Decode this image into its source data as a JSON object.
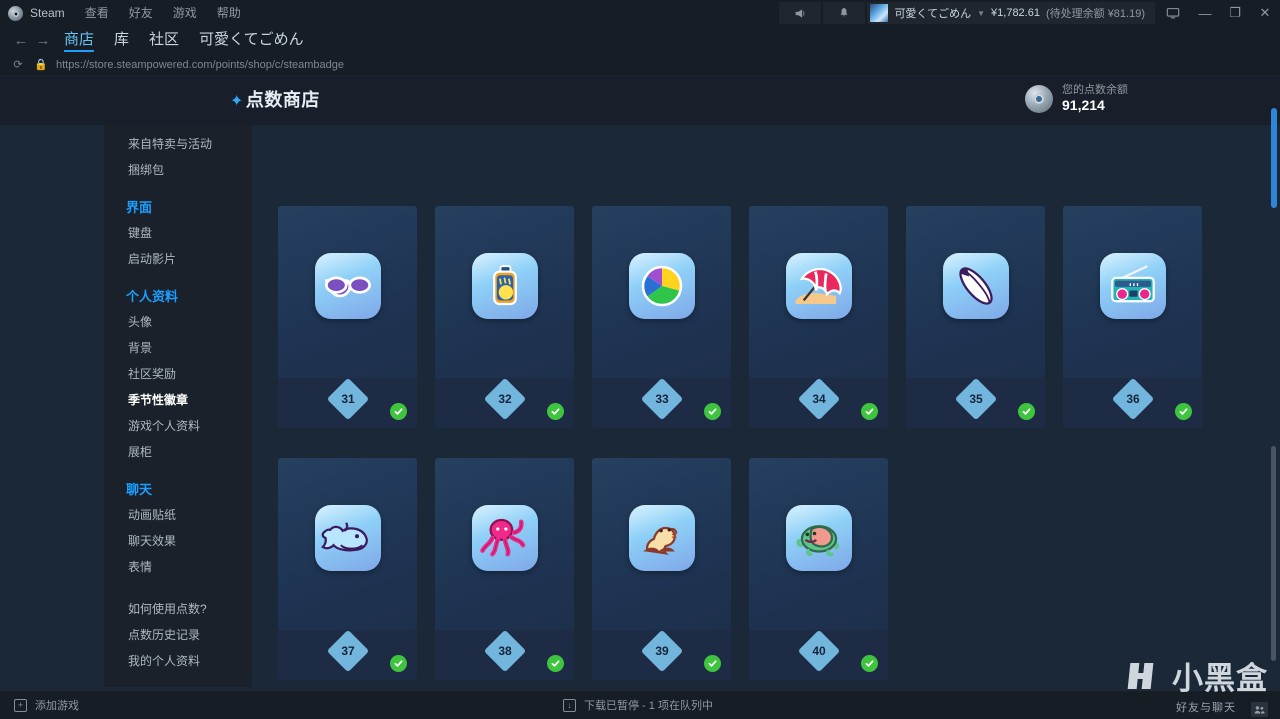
{
  "window": {
    "brand": "Steam",
    "menus": [
      "查看",
      "好友",
      "游戏",
      "帮助"
    ],
    "broadcast_icon": "megaphone-icon",
    "notifications_icon": "bell-icon",
    "account_name": "可愛くてごめん",
    "account_balance": "¥1,782.61",
    "account_pending": "(待处理余额 ¥81.19)",
    "caret_icon": "chevron-down-icon",
    "bigpicture_icon": "display-icon",
    "minimize_icon": "—",
    "maximize_icon": "❐",
    "close_icon": "✕"
  },
  "nav": {
    "back_icon": "←",
    "forward_icon": "→",
    "tabs": [
      {
        "label": "商店",
        "active": true
      },
      {
        "label": "库",
        "active": false
      },
      {
        "label": "社区",
        "active": false
      },
      {
        "label": "可愛くてごめん",
        "active": false
      }
    ],
    "reload_icon": "reload-icon",
    "lock_icon": "lock-icon",
    "url": "https://store.steampowered.com/points/shop/c/steambadge"
  },
  "shop": {
    "sparkle_icon": "sparkle-icon",
    "title": "点数商店",
    "points_icon": "steam-points-icon",
    "points_label": "您的点数余额",
    "points_value": "91,214"
  },
  "sidebar": {
    "items": [
      {
        "label": "来自特卖与活动",
        "type": "item"
      },
      {
        "label": "捆绑包",
        "type": "item"
      },
      {
        "label": "界面",
        "type": "head"
      },
      {
        "label": "键盘",
        "type": "item"
      },
      {
        "label": "启动影片",
        "type": "item"
      },
      {
        "label": "个人资料",
        "type": "head"
      },
      {
        "label": "头像",
        "type": "item"
      },
      {
        "label": "背景",
        "type": "item"
      },
      {
        "label": "社区奖励",
        "type": "item"
      },
      {
        "label": "季节性徽章",
        "type": "item",
        "selected": true,
        "star": "★"
      },
      {
        "label": "游戏个人资料",
        "type": "item"
      },
      {
        "label": "展柜",
        "type": "item"
      },
      {
        "label": "聊天",
        "type": "head"
      },
      {
        "label": "动画贴纸",
        "type": "item"
      },
      {
        "label": "聊天效果",
        "type": "item"
      },
      {
        "label": "表情",
        "type": "item"
      },
      {
        "label": "",
        "type": "gap"
      },
      {
        "label": "如何使用点数?",
        "type": "item"
      },
      {
        "label": "点数历史记录",
        "type": "item"
      },
      {
        "label": "我的个人资料",
        "type": "item"
      }
    ]
  },
  "grid": {
    "owned_icon": "check-circle-icon",
    "rows": [
      [
        {
          "number": "31",
          "icon": "sunglasses-icon"
        },
        {
          "number": "32",
          "icon": "sunscreen-bottle-icon"
        },
        {
          "number": "33",
          "icon": "beach-ball-icon"
        },
        {
          "number": "34",
          "icon": "beach-umbrella-icon"
        },
        {
          "number": "35",
          "icon": "surfboard-icon"
        },
        {
          "number": "36",
          "icon": "boombox-icon"
        }
      ],
      [
        {
          "number": "37",
          "icon": "shark-icon"
        },
        {
          "number": "38",
          "icon": "octopus-icon"
        },
        {
          "number": "39",
          "icon": "seal-icon"
        },
        {
          "number": "40",
          "icon": "turtle-icon"
        }
      ]
    ]
  },
  "statusbar": {
    "add_game_icon": "plus-box-icon",
    "add_game_label": "添加游戏",
    "download_icon": "download-icon",
    "download_status": "下载已暂停 - 1 项在队列中"
  },
  "watermark": {
    "logo_icon": "xiaoheihe-logo-icon",
    "text": "小黑盒",
    "subtitle": "好友与聊天",
    "chat_icon": "friends-icon"
  },
  "colors": {
    "accent_blue": "#1a9fff",
    "link_blue": "#66c0f4",
    "owned_green": "#3ec43e",
    "diamond_blue": "#72b5dd",
    "page_bg": "#1b2838",
    "chrome_bg": "#171d25"
  }
}
